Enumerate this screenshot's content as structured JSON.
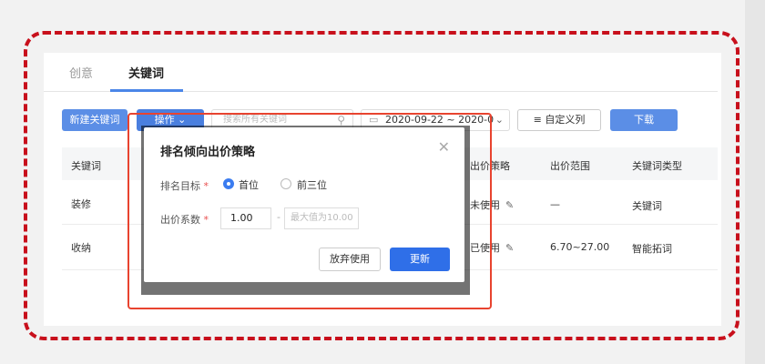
{
  "tabs": [
    {
      "label": "创意"
    },
    {
      "label": "关键词"
    }
  ],
  "toolbar": {
    "new_keyword": "新建关键词",
    "operation": "操作 ⌄",
    "search_placeholder": "搜索所有关键词",
    "date_range": "2020-09-22 ~ 2020-0",
    "custom_columns": "自定义列",
    "download": "下载"
  },
  "table": {
    "headers": [
      "关键词",
      "出价策略",
      "出价范围",
      "关键词类型"
    ],
    "rows": [
      {
        "keyword": "装修",
        "strategy": "未使用",
        "range": "—",
        "type": "关键词"
      },
      {
        "keyword": "收纳",
        "strategy": "已使用",
        "range": "6.70~27.00",
        "type": "智能拓词"
      }
    ]
  },
  "modal": {
    "title": "排名倾向出价策略",
    "target_label": "排名目标",
    "required_mark": "*",
    "option_first": "首位",
    "option_top3": "前三位",
    "coef_label": "出价系数",
    "coef_value": "1.00",
    "separator": "-",
    "max_placeholder": "最大值为10.00",
    "discard": "放弃使用",
    "update": "更新"
  },
  "icons": {
    "close": "close-icon",
    "search": "search-icon",
    "calendar": "calendar-icon",
    "edit": "edit-icon"
  },
  "colors": {
    "accent": "#2f6fe8",
    "annotation": "#c8101c"
  }
}
